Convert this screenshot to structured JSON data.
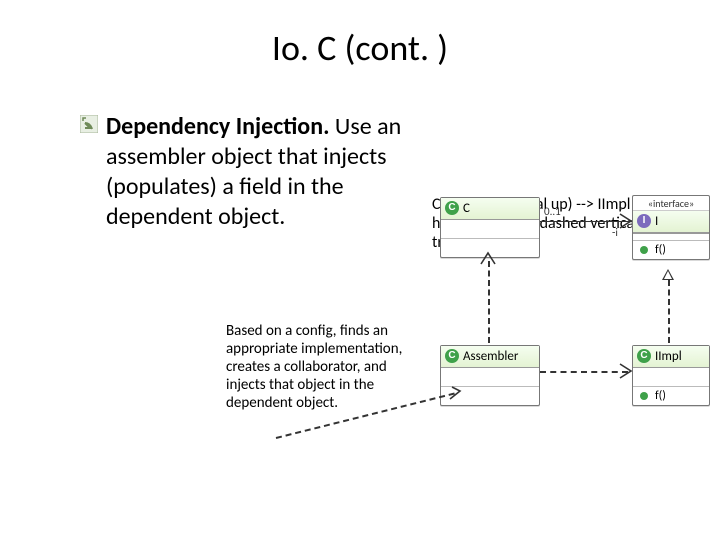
{
  "title": "Io. C (cont. )",
  "bullet": {
    "strong": "Dependency Injection.",
    "rest": " Use an assembler object that injects (populates) a field in the dependent object."
  },
  "subnote": "Based on a config, finds an appropriate implementation, creates a collaborator, and injects that object in the dependent object.",
  "uml": {
    "c_badge": "C",
    "c_label": "C",
    "i_stereo": "«interface»",
    "i_badge": "I",
    "i_label": "I",
    "i_method": "f()",
    "assembler_badge": "C",
    "assembler_label": "Assembler",
    "iimpl_badge": "C",
    "iimpl_label": "IImpl",
    "iimpl_method": "f()",
    "mult_left": "0..1",
    "mult_right": "*",
    "role": "-i"
  }
}
